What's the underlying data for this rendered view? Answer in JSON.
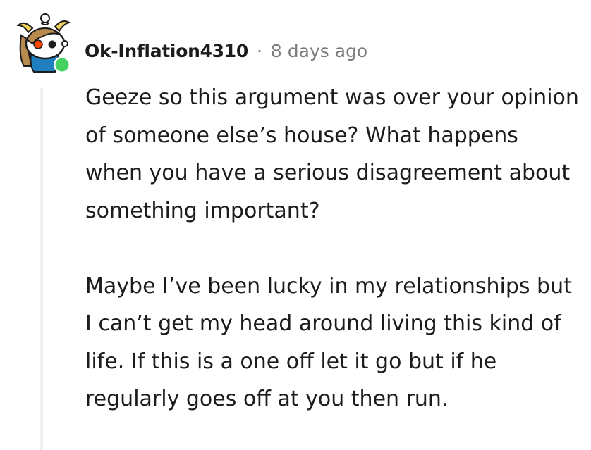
{
  "comment": {
    "username": "Ok-Inflation4310",
    "separator": "·",
    "timestamp": "8 days ago",
    "online_status_color": "#46d160",
    "paragraphs": [
      "Geeze so this argument was over your opinion of someone else’s house? What happens when you have a serious disagreement about something important?",
      "Maybe I’ve been lucky in my relationships but I can’t get my head around living this kind of life. If this is a one off let it go but if he regularly goes off at you then run."
    ]
  }
}
